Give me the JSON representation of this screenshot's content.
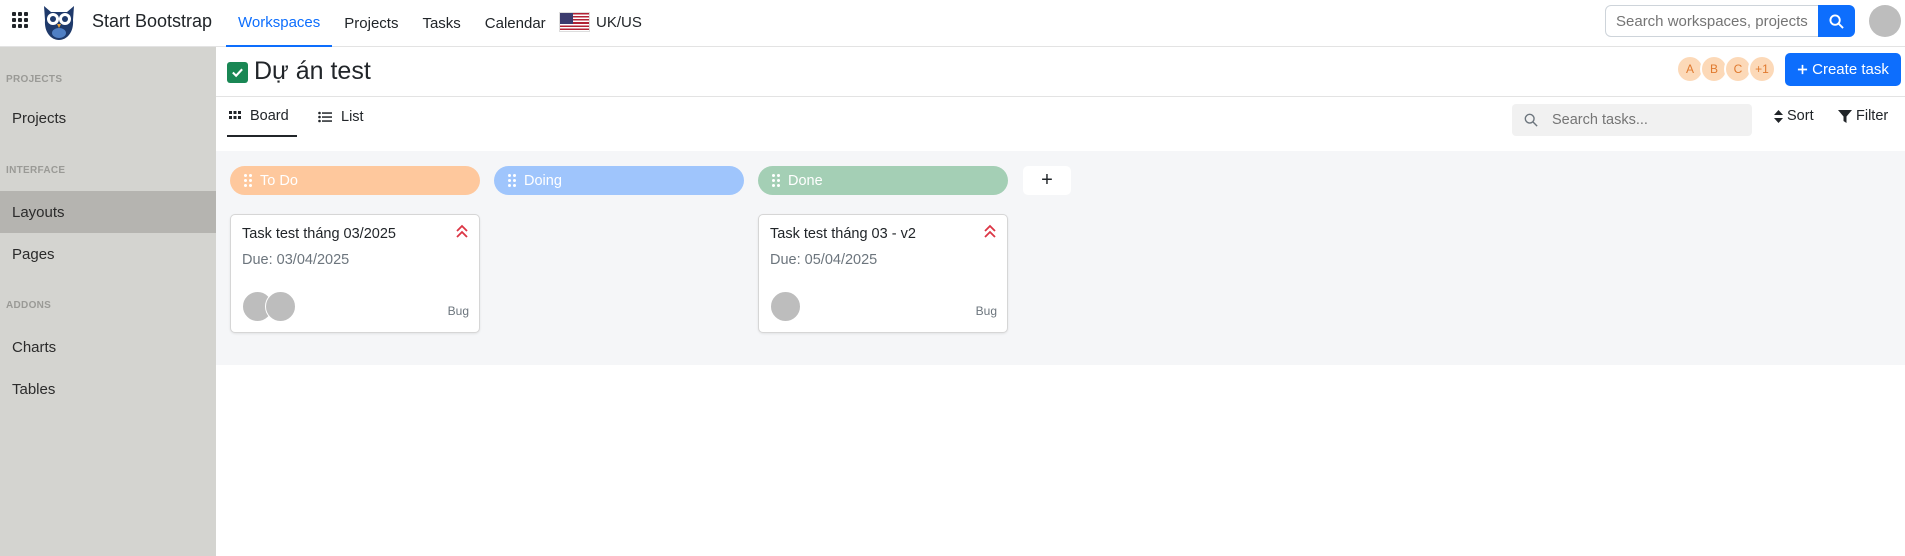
{
  "topbar": {
    "brand": "Start Bootstrap",
    "nav": [
      "Workspaces",
      "Projects",
      "Tasks",
      "Calendar"
    ],
    "active_nav": "Workspaces",
    "locale": "UK/US",
    "search_placeholder": "Search workspaces, projects"
  },
  "sidebar": {
    "headings": [
      "PROJECTS",
      "INTERFACE",
      "ADDONS"
    ],
    "items": [
      "Projects",
      "Layouts",
      "Pages",
      "Charts",
      "Tables"
    ],
    "active_item": "Layouts"
  },
  "header": {
    "title": "Dự án test",
    "members": [
      "A",
      "B",
      "C",
      "+1"
    ],
    "create_label": "Create task"
  },
  "toolbar": {
    "tabs": [
      "Board",
      "List"
    ],
    "active_tab": "Board",
    "search_placeholder": "Search tasks...",
    "sort_label": "Sort",
    "filter_label": "Filter"
  },
  "board": {
    "add_column_label": "+",
    "columns": [
      {
        "name": "To Do",
        "color": "#fec89d"
      },
      {
        "name": "Doing",
        "color": "#9fc5fc"
      },
      {
        "name": "Done",
        "color": "#a4cfb5"
      }
    ],
    "cards": [
      {
        "column": "To Do",
        "title": "Task test tháng 03/2025",
        "due": "Due: 03/04/2025",
        "tag": "Bug",
        "assignees": 2,
        "priority_color": "#dc3545"
      },
      {
        "column": "Done",
        "title": "Task test tháng 03 - v2",
        "due": "Due: 05/04/2025",
        "tag": "Bug",
        "assignees": 1,
        "priority_color": "#dc3545"
      }
    ]
  }
}
